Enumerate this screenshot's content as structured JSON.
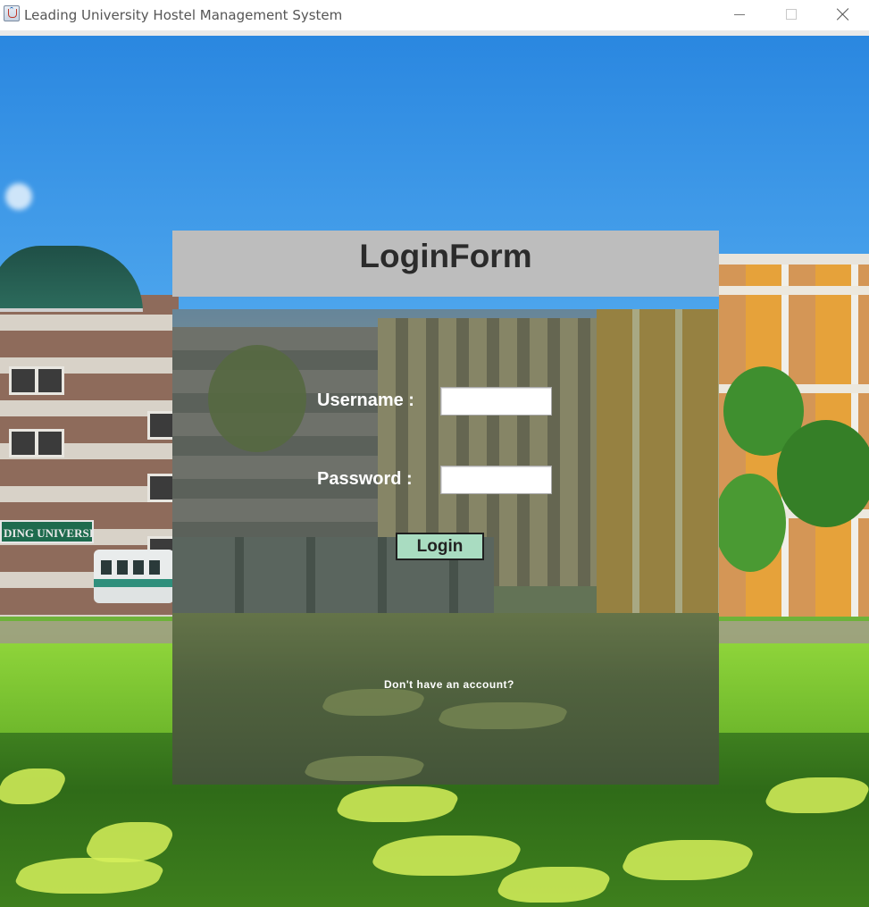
{
  "window": {
    "title": "Leading University Hostel Management System",
    "controls": {
      "minimize_icon": "minimize-icon",
      "maximize_icon": "maximize-icon",
      "close_icon": "close-icon"
    }
  },
  "background": {
    "sign_text": "DING UNIVERSITY"
  },
  "form": {
    "title": "LoginForm",
    "username_label": "Username :",
    "password_label": "Password :",
    "username_value": "",
    "password_value": "",
    "login_button": "Login",
    "signup_link": "Don't have an account?"
  },
  "colors": {
    "header_bg": "#bdbdbd",
    "login_button_bg": "#a9dcc1",
    "label_text": "#ffffff"
  }
}
